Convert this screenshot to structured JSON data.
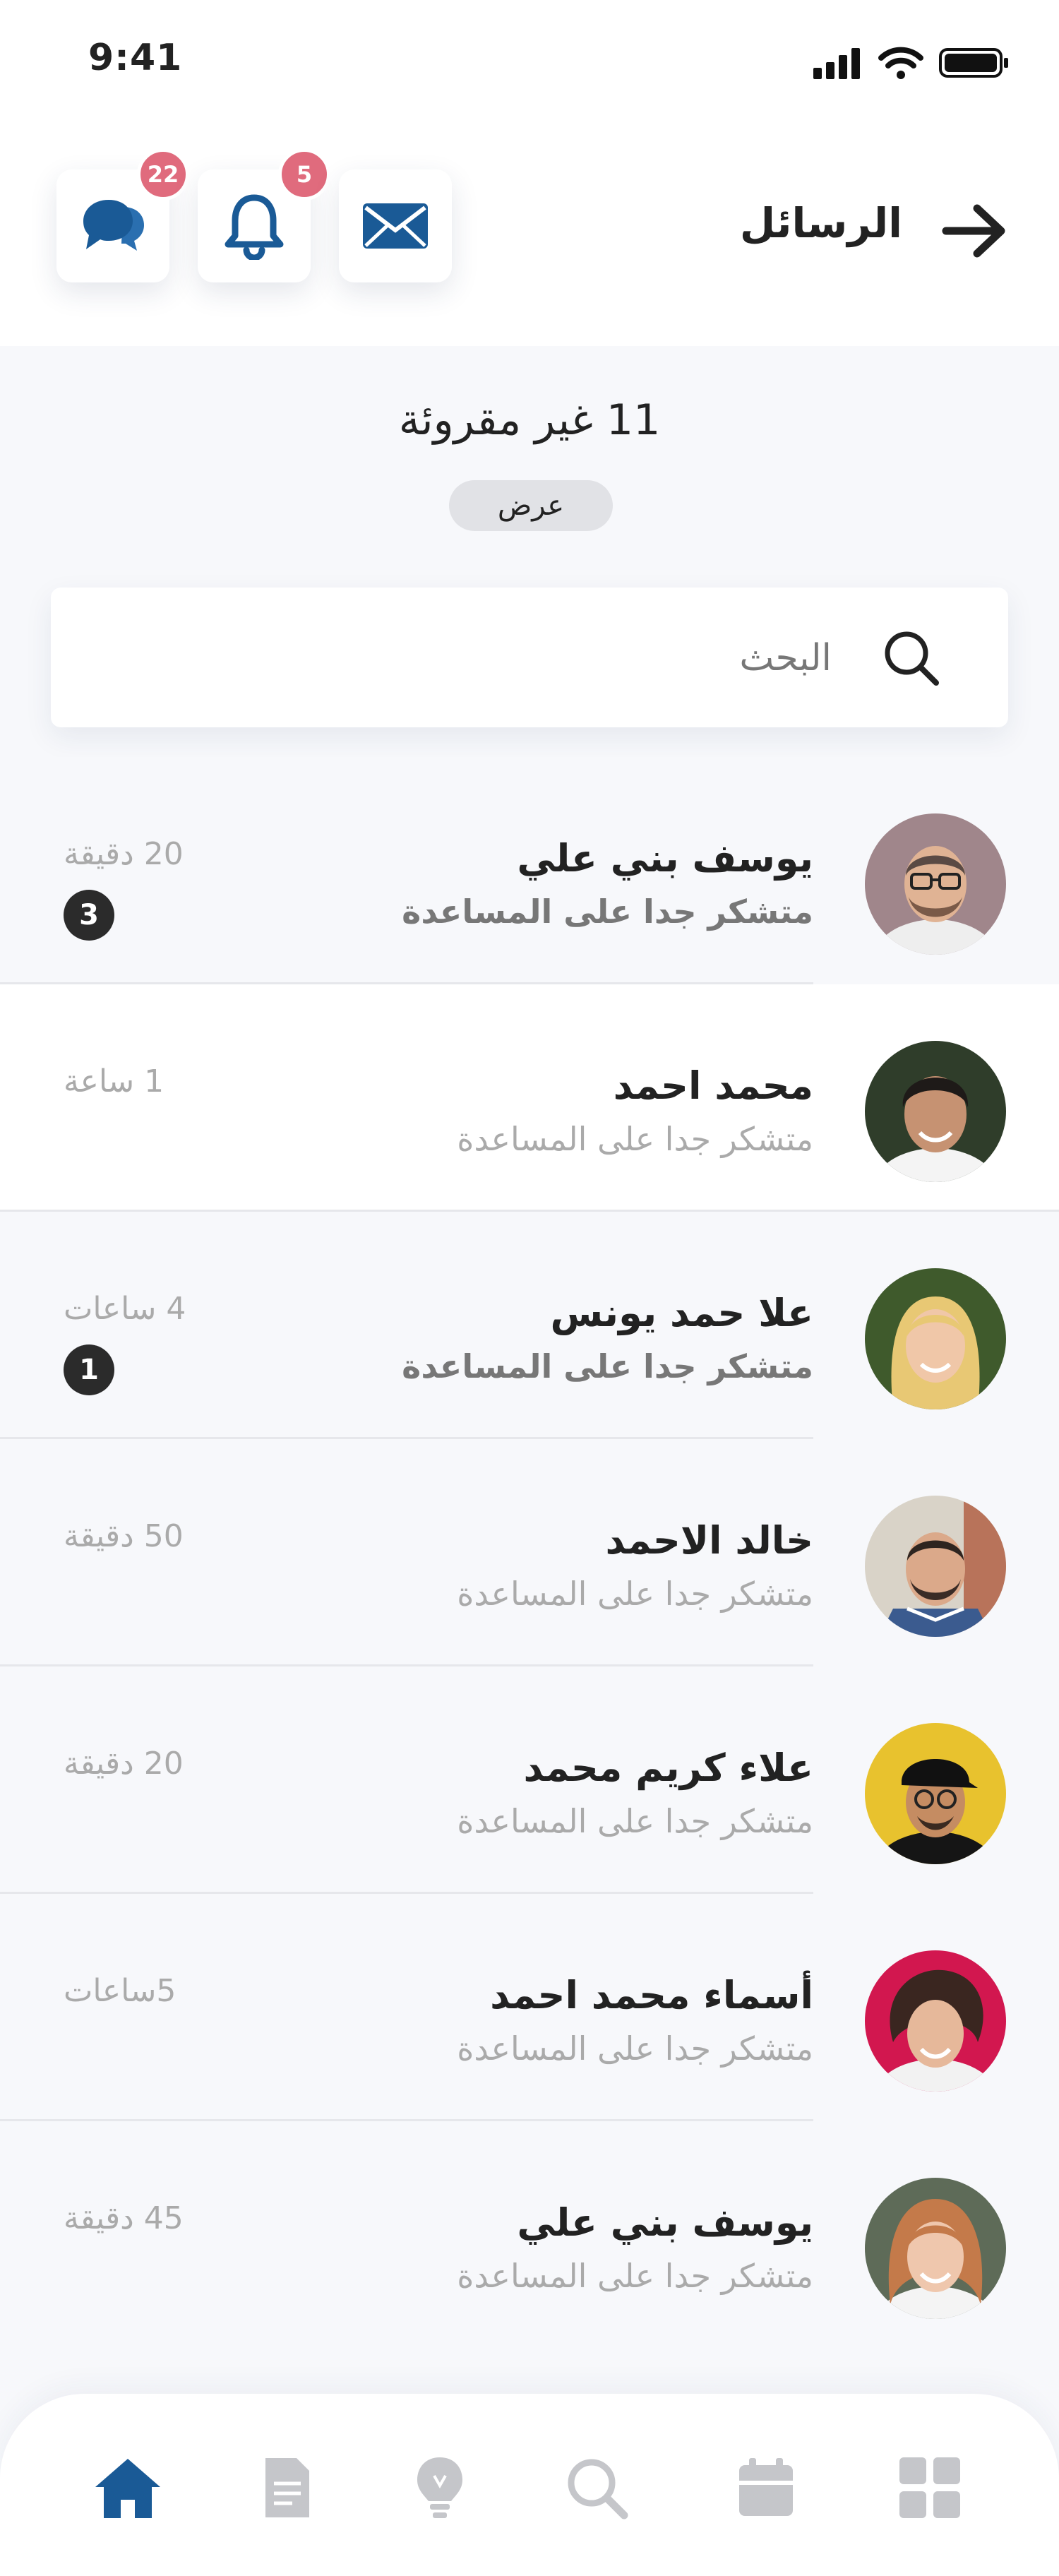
{
  "status_bar": {
    "time": "9:41"
  },
  "header": {
    "title": "الرسائل",
    "chat_badge": "22",
    "bell_badge": "5"
  },
  "unread": {
    "text": "11 غير مقروئة",
    "show_label": "عرض"
  },
  "search": {
    "placeholder": "البحث"
  },
  "conversations": [
    {
      "name": "يوسف بني علي",
      "message": "متشكر جدا على المساعدة",
      "time": "20   دقيقة",
      "unread": "3"
    },
    {
      "name": "محمد احمد",
      "message": "متشكر جدا على المساعدة",
      "time": "1  ساعة"
    },
    {
      "name": "علا حمد يونس",
      "message": "متشكر جدا على المساعدة",
      "time": "4 ساعات",
      "unread": "1"
    },
    {
      "name": "خالد الاحمد",
      "message": "متشكر جدا على المساعدة",
      "time": "50  دقيقة"
    },
    {
      "name": "علاء كريم محمد",
      "message": "متشكر جدا على المساعدة",
      "time": "20   دقيقة"
    },
    {
      "name": "أسماء محمد احمد",
      "message": "متشكر جدا على المساعدة",
      "time": "5ساعات"
    },
    {
      "name": "يوسف بني علي",
      "message": "متشكر جدا على المساعدة",
      "time": "45  دقيقة"
    }
  ],
  "bottom_nav": [
    "home-icon",
    "document-icon",
    "lightbulb-icon",
    "search-icon",
    "calendar-icon",
    "grid-icon"
  ],
  "colors": {
    "accent": "#1a5a96",
    "badge": "#e06b7d",
    "inactive": "#c5c6ca"
  }
}
